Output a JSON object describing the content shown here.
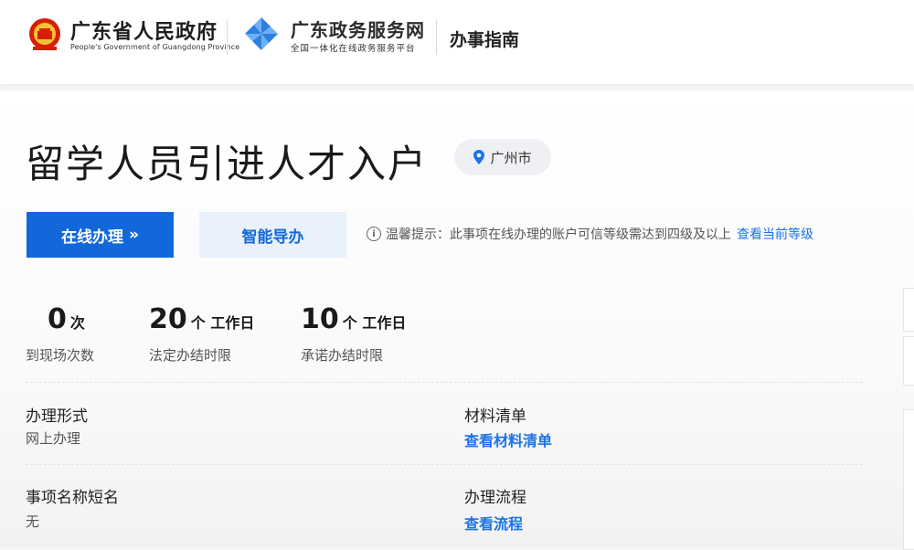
{
  "header": {
    "gov_title": "广东省人民政府",
    "gov_subtitle": "People's Government of Guangdong Province",
    "service_title": "广东政务服务网",
    "service_subtitle": "全国一体化在线政务服务平台",
    "guide_label": "办事指南"
  },
  "item": {
    "title": "留学人员引进人才入户",
    "location": "广州市"
  },
  "actions": {
    "online_label": "在线办理",
    "online_chevron": "»",
    "smart_label": "智能导办"
  },
  "tip": {
    "icon": "i",
    "text": "温馨提示：此事项在线办理的账户可信等级需达到四级及以上",
    "link": "查看当前等级"
  },
  "stats": [
    {
      "value": "0",
      "unit": "次",
      "label": "到现场次数"
    },
    {
      "value": "20",
      "unit": "个 工作日",
      "label": "法定办结时限"
    },
    {
      "value": "10",
      "unit": "个 工作日",
      "label": "承诺办结时限"
    }
  ],
  "info": {
    "form_label": "办理形式",
    "form_value": "网上办理",
    "materials_label": "材料清单",
    "materials_link": "查看材料清单",
    "short_name_label": "事项名称短名",
    "short_name_value": "无",
    "process_label": "办理流程",
    "process_link": "查看流程"
  },
  "colors": {
    "primary": "#1268db",
    "link": "#1a73e8",
    "secondary_bg": "#e8f1fc"
  },
  "icons": {
    "emblem": "national-emblem-icon",
    "service_logo": "pinwheel-logo-icon",
    "location": "location-pin-icon",
    "info": "info-circle-icon"
  }
}
